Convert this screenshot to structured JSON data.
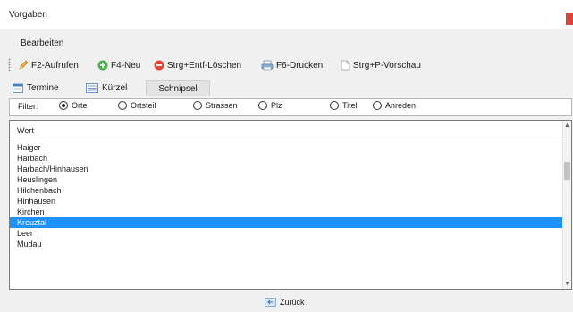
{
  "window": {
    "title": "Vorgaben",
    "close_color": "#d9443a"
  },
  "menu": {
    "items": [
      {
        "label": "Bearbeiten"
      }
    ]
  },
  "toolbar": {
    "f2": {
      "label": "F2-Aufrufen",
      "icon": "pencil-icon"
    },
    "f4": {
      "label": "F4-Neu",
      "icon": "plus-circle-icon"
    },
    "delete": {
      "label": "Strg+Entf-Löschen",
      "icon": "minus-circle-icon"
    },
    "print": {
      "label": "F6-Drucken",
      "icon": "printer-icon"
    },
    "preview": {
      "label": "Strg+P-Vorschau",
      "icon": "document-icon"
    }
  },
  "tabs": [
    {
      "label": "Termine",
      "icon": "calendar-icon"
    },
    {
      "label": "Kürzel",
      "icon": "list-icon"
    },
    {
      "label": "Schnipsel",
      "active": true
    }
  ],
  "filter": {
    "label": "Filter:",
    "options": [
      {
        "label": "Orte",
        "checked": true
      },
      {
        "label": "Ortsteil",
        "checked": false
      },
      {
        "label": "Strassen",
        "checked": false
      },
      {
        "label": "Plz",
        "checked": false
      },
      {
        "label": "Titel",
        "checked": false
      },
      {
        "label": "Anreden",
        "checked": false
      }
    ]
  },
  "list": {
    "column_header": "Wert",
    "rows": [
      "Haiger",
      "Harbach",
      "Harbach/Hinhausen",
      "Heuslingen",
      "Hilchenbach",
      "Hinhausen",
      "Kirchen",
      "Kreuztal",
      "Leer",
      "Mudau"
    ],
    "selected_index": 7,
    "selection_color": "#1e90ff"
  },
  "footer": {
    "back_label": "Zurück",
    "back_icon": "back-arrow-icon"
  }
}
